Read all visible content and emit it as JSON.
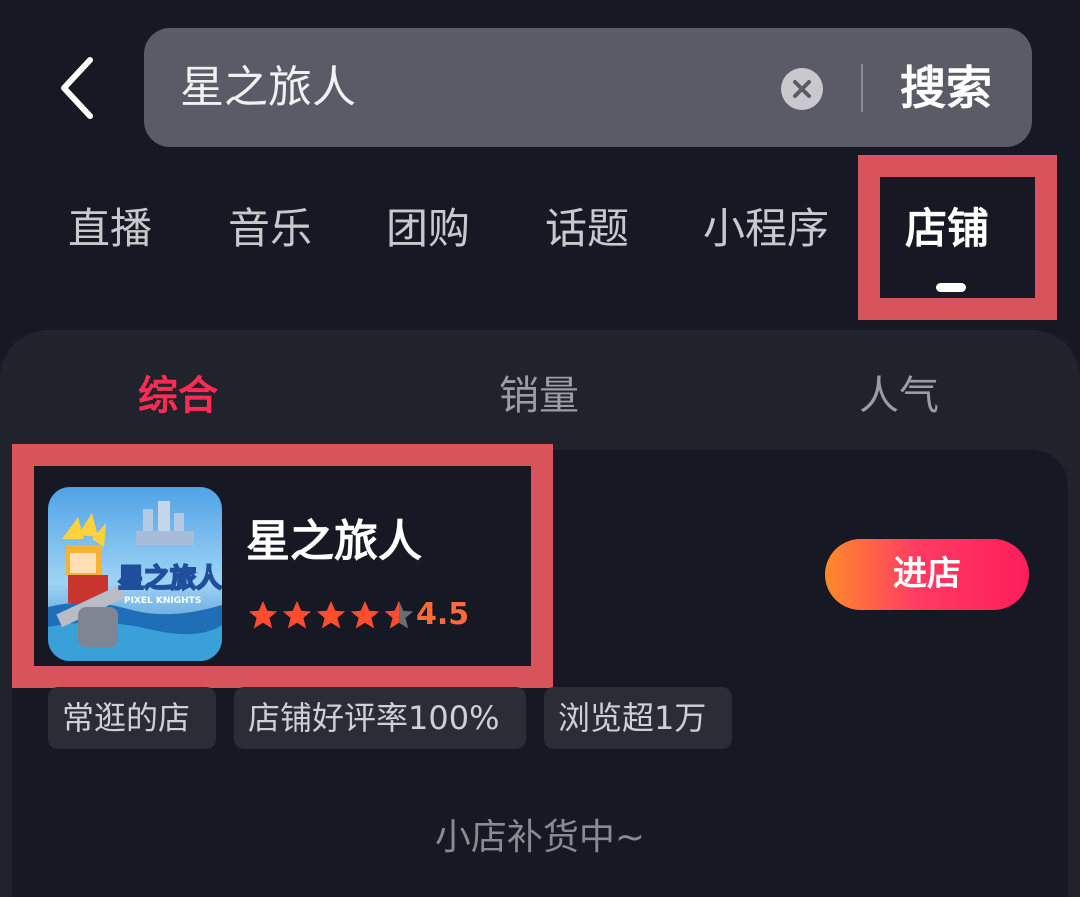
{
  "search": {
    "query": "星之旅人",
    "button_label": "搜索"
  },
  "tabs": [
    {
      "label": "直播"
    },
    {
      "label": "音乐"
    },
    {
      "label": "团购"
    },
    {
      "label": "话题"
    },
    {
      "label": "小程序"
    },
    {
      "label": "店铺",
      "active": true
    }
  ],
  "sort_tabs": [
    {
      "label": "综合",
      "active": true
    },
    {
      "label": "销量"
    },
    {
      "label": "人气"
    }
  ],
  "shop": {
    "name": "星之旅人",
    "rating": "4.5",
    "rating_value": 4.5,
    "enter_label": "进店",
    "logo_text": "星之旅人",
    "logo_subtext": "PIXEL KNIGHTS",
    "tags": [
      "常逛的店",
      "店铺好评率100%",
      "浏览超1万"
    ],
    "restock_note": "小店补货中~"
  },
  "colors": {
    "background": "#161823",
    "accent": "#fe2c55",
    "rating": "#ff6a3d",
    "highlight": "#d9545a"
  },
  "icons": {
    "back": "back-arrow-icon",
    "clear": "clear-icon",
    "star": "star-icon"
  }
}
